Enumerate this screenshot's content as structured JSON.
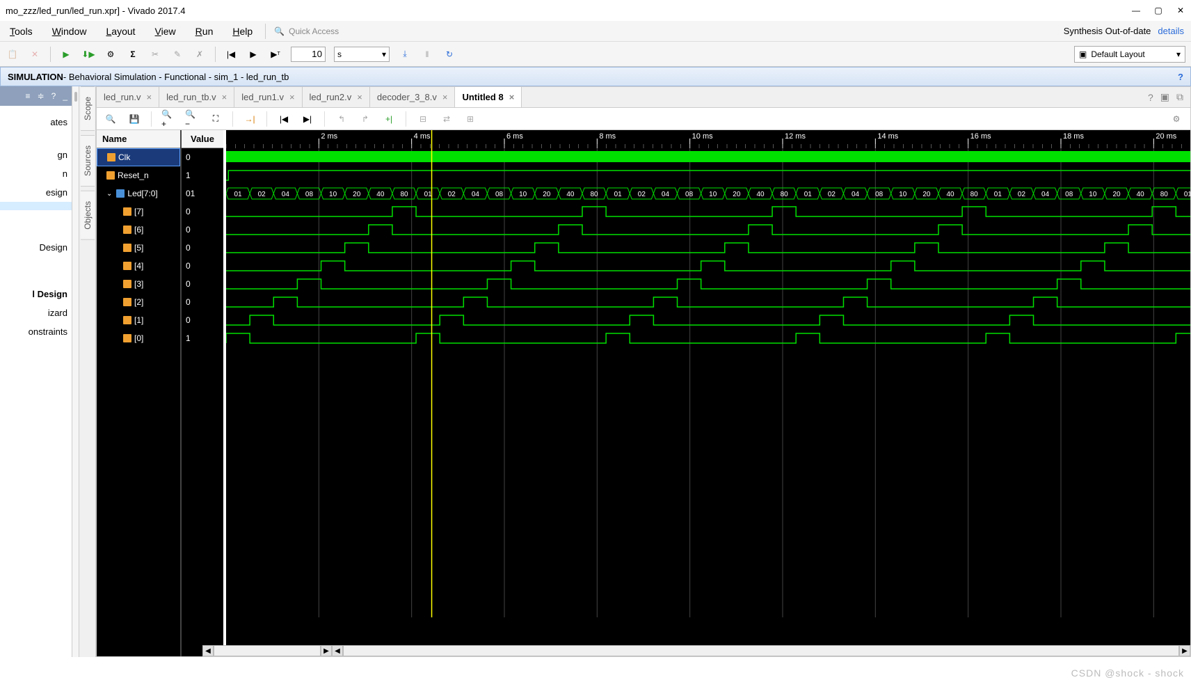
{
  "title": "mo_zzz/led_run/led_run.xpr] - Vivado 2017.4",
  "menu": [
    "Tools",
    "Window",
    "Layout",
    "View",
    "Run",
    "Help"
  ],
  "quick_access_placeholder": "Quick Access",
  "synthesis_status": "Synthesis Out-of-date",
  "details_label": "details",
  "time_value": "10",
  "time_unit": "s",
  "layout_select": "Default Layout",
  "banner": {
    "prefix": "SIMULATION",
    "rest": " - Behavioral Simulation - Functional - sim_1 - led_run_tb"
  },
  "left_nav": [
    {
      "label": "ates",
      "highlight": false,
      "cat": false
    },
    {
      "label": "",
      "highlight": false,
      "cat": false,
      "spacer": true
    },
    {
      "label": "gn",
      "highlight": false,
      "cat": false
    },
    {
      "label": "n",
      "highlight": false,
      "cat": false
    },
    {
      "label": "esign",
      "highlight": false,
      "cat": false
    },
    {
      "label": "",
      "highlight": true,
      "cat": false
    },
    {
      "label": "",
      "highlight": false,
      "cat": false,
      "spacer": true
    },
    {
      "label": "",
      "highlight": false,
      "cat": false,
      "spacer": true
    },
    {
      "label": "Design",
      "highlight": false,
      "cat": false
    },
    {
      "label": "",
      "highlight": false,
      "cat": false,
      "spacer": true
    },
    {
      "label": "",
      "highlight": false,
      "cat": false,
      "spacer": true
    },
    {
      "label": "l Design",
      "highlight": false,
      "cat": true
    },
    {
      "label": "izard",
      "highlight": false,
      "cat": false
    },
    {
      "label": "onstraints",
      "highlight": false,
      "cat": false
    }
  ],
  "vtabs": [
    "Scope",
    "Sources",
    "Objects"
  ],
  "file_tabs": [
    {
      "label": "led_run.v",
      "active": false
    },
    {
      "label": "led_run_tb.v",
      "active": false
    },
    {
      "label": "led_run1.v",
      "active": false
    },
    {
      "label": "led_run2.v",
      "active": false
    },
    {
      "label": "decoder_3_8.v",
      "active": false
    },
    {
      "label": "Untitled 8",
      "active": true
    }
  ],
  "sig_headers": {
    "name": "Name",
    "value": "Value"
  },
  "signals": [
    {
      "name": "Clk",
      "value": "0",
      "indent": false,
      "selected": true,
      "icon": "std"
    },
    {
      "name": "Reset_n",
      "value": "1",
      "indent": false,
      "selected": false,
      "icon": "std"
    },
    {
      "name": "Led[7:0]",
      "value": "01",
      "indent": false,
      "selected": false,
      "icon": "bus",
      "expand": true
    },
    {
      "name": "[7]",
      "value": "0",
      "indent": true,
      "selected": false,
      "icon": "std"
    },
    {
      "name": "[6]",
      "value": "0",
      "indent": true,
      "selected": false,
      "icon": "std"
    },
    {
      "name": "[5]",
      "value": "0",
      "indent": true,
      "selected": false,
      "icon": "std"
    },
    {
      "name": "[4]",
      "value": "0",
      "indent": true,
      "selected": false,
      "icon": "std"
    },
    {
      "name": "[3]",
      "value": "0",
      "indent": true,
      "selected": false,
      "icon": "std"
    },
    {
      "name": "[2]",
      "value": "0",
      "indent": true,
      "selected": false,
      "icon": "std"
    },
    {
      "name": "[1]",
      "value": "0",
      "indent": true,
      "selected": false,
      "icon": "std"
    },
    {
      "name": "[0]",
      "value": "1",
      "indent": true,
      "selected": false,
      "icon": "std"
    }
  ],
  "cursor_time": "4.433098456 ms",
  "ruler_labels": [
    "2 ms",
    "4 ms",
    "6 ms",
    "8 ms",
    "10 ms",
    "12 ms",
    "14 ms",
    "16 ms",
    "18 ms",
    "20 ms"
  ],
  "bus_values": [
    "01",
    "02",
    "04",
    "08",
    "10",
    "20",
    "40",
    "80",
    "01",
    "02",
    "04",
    "08",
    "10",
    "20",
    "40",
    "80",
    "01",
    "02",
    "04",
    "08",
    "10",
    "20",
    "40",
    "80",
    "01",
    "02",
    "04",
    "08",
    "10",
    "20",
    "40",
    "80",
    "01",
    "02",
    "04",
    "08",
    "10",
    "20",
    "40",
    "80",
    "01"
  ],
  "chart_data": {
    "type": "timing-diagram",
    "time_unit": "ms",
    "time_range": [
      0,
      21
    ],
    "cursor": 4.433098456,
    "period_ms": 0.512,
    "signals": {
      "Clk": {
        "kind": "clock",
        "freq_high": true
      },
      "Reset_n": {
        "kind": "level",
        "value": 1,
        "brief_low_at": [
          0
        ]
      },
      "Led[7:0]": {
        "kind": "bus",
        "pattern": [
          "01",
          "02",
          "04",
          "08",
          "10",
          "20",
          "40",
          "80"
        ],
        "repeats": 5,
        "step_ms": 0.512
      },
      "Led_bits": {
        "kind": "onehot",
        "width": 8,
        "step_ms": 0.512,
        "repeats": 5
      }
    }
  },
  "watermark": "CSDN @shock - shock"
}
